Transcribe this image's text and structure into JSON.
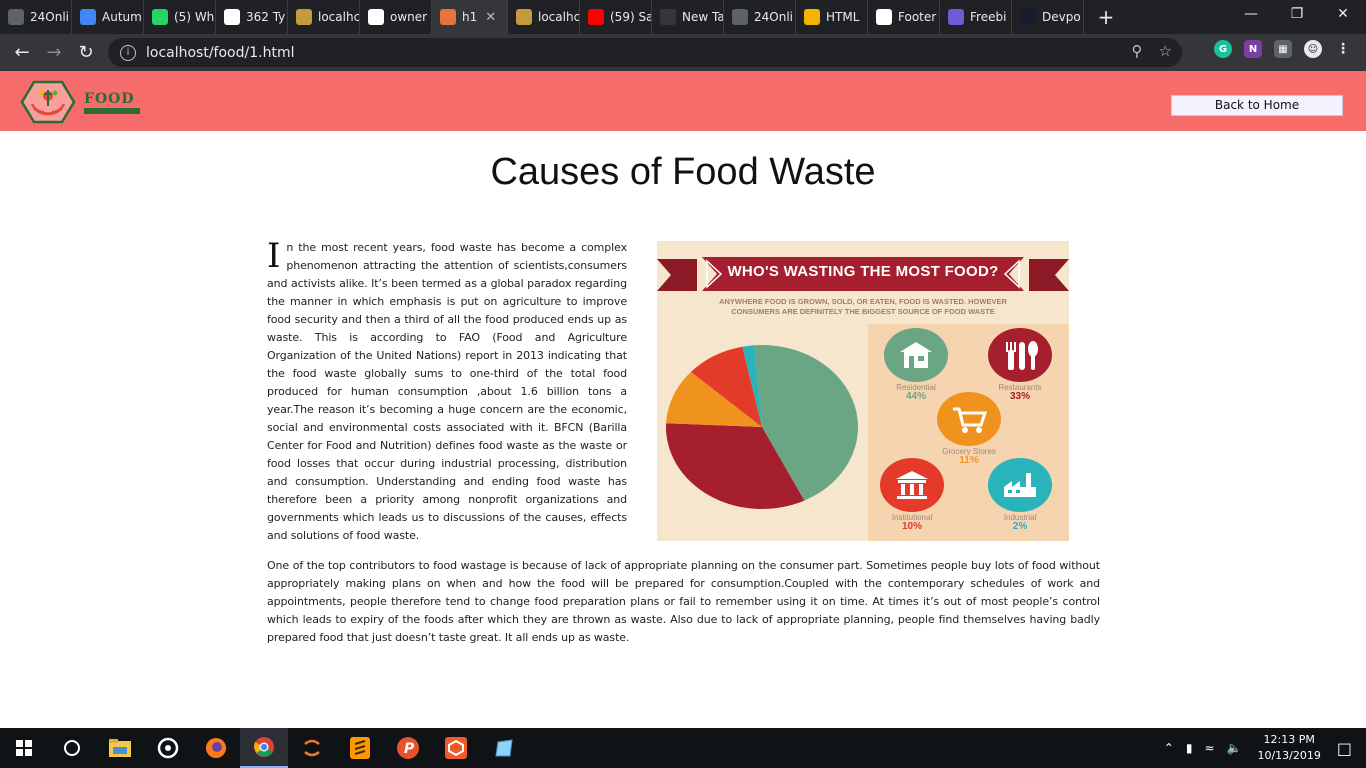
{
  "browser": {
    "tabs": [
      {
        "label": "24Onli",
        "color": "#5f6368"
      },
      {
        "label": "Autum",
        "color": "#4285f4"
      },
      {
        "label": "(5) Wh",
        "color": "#25d366"
      },
      {
        "label": "362 Ty",
        "color": "#ffffff"
      },
      {
        "label": "localhc",
        "color": "#c49a3a"
      },
      {
        "label": "owner",
        "color": "#ffffff"
      },
      {
        "label": "h1",
        "color": "#e8743b"
      },
      {
        "label": "localhc",
        "color": "#c49a3a"
      },
      {
        "label": "(59) Sa",
        "color": "#ff0000"
      },
      {
        "label": "New Tab",
        "color": "#35363a"
      },
      {
        "label": "24Onli",
        "color": "#5f6368"
      },
      {
        "label": "HTML",
        "color": "#f4b400"
      },
      {
        "label": "Footer",
        "color": "#ffffff"
      },
      {
        "label": "Freebi",
        "color": "#6e5bd6"
      },
      {
        "label": "Devpo",
        "color": "#1a1a2e"
      }
    ],
    "active_tab_index": 6,
    "url": "localhost/food/1.html"
  },
  "site": {
    "logo_text": "FOOD",
    "back_button": "Back to Home"
  },
  "article": {
    "title": "Causes of Food Waste",
    "dropcap": "I",
    "para1": "n the most recent years, food waste has become a complex phenomenon attracting the attention of scientists,consumers and activists alike. It’s been termed as a global paradox regarding the manner in which emphasis is put on agriculture to improve food security and then a third of all the food produced ends up as waste. This is according to FAO (Food and Agriculture Organization of the United Nations) report in 2013 indicating that the food waste globally sums to one-third of the total food produced for human consumption ,about 1.6 billion tons a year.The reason it’s becoming a huge concern are the economic, social and environmental costs associated with it. BFCN (Barilla Center for Food and Nutrition) defines food waste as the waste or food losses that occur during industrial processing, distribution and consumption. Understanding and ending food waste has therefore been a priority among nonprofit organizations and governments which leads us to discussions of the causes, effects and solutions of food waste.",
    "para2": "One of the top contributors to food wastage is because of lack of appropriate planning on the consumer part. Sometimes people buy lots of food without appropriately making plans on when and how the food will be prepared for consumption.Coupled with the contemporary schedules of work and appointments, people therefore tend to change food preparation plans or fail to remember using it on time. At times it’s out of most people’s control which leads to expiry of the foods after which they are thrown as waste. Also due to lack of appropriate planning, people find themselves having badly prepared food that just doesn’t taste great. It all ends up as waste."
  },
  "infographic": {
    "title": "WHO'S WASTING THE MOST FOOD?",
    "subtitle_line1": "ANYWHERE FOOD IS GROWN, SOLD, OR EATEN, FOOD IS WASTED. HOWEVER",
    "subtitle_line2": "CONSUMERS ARE DEFINITELY THE BIGGEST SOURCE OF FOOD WASTE",
    "slices": [
      {
        "name": "Residential",
        "value": 44,
        "pct": "44%",
        "color": "#6aa584",
        "icon": "house-icon"
      },
      {
        "name": "Restaurants",
        "value": 33,
        "pct": "33%",
        "color": "#a51f2e",
        "icon": "cutlery-icon"
      },
      {
        "name": "Grocery Stores",
        "value": 11,
        "pct": "11%",
        "color": "#f0931e",
        "icon": "cart-icon"
      },
      {
        "name": "Institutional",
        "value": 10,
        "pct": "10%",
        "color": "#e43a2a",
        "icon": "building-icon"
      },
      {
        "name": "Industrial",
        "value": 2,
        "pct": "2%",
        "color": "#2ab3bb",
        "icon": "factory-icon"
      }
    ]
  },
  "taskbar": {
    "time": "12:13 PM",
    "date": "10/13/2019"
  }
}
